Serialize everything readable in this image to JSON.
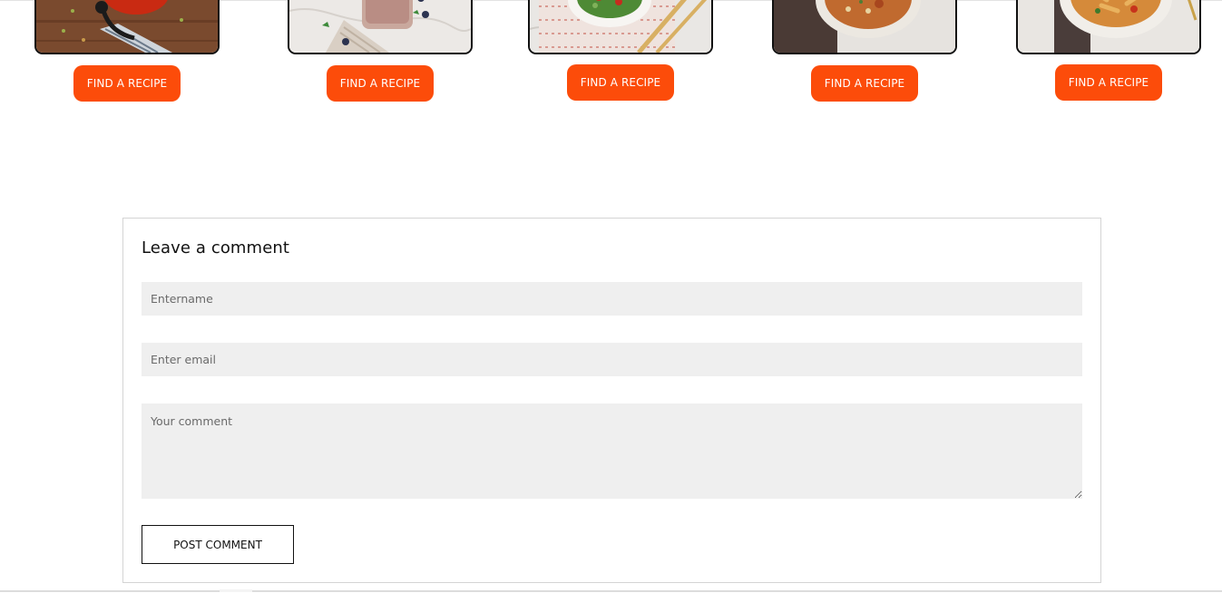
{
  "recipes": [
    {
      "button_label": "FIND A RECIPE",
      "image": "tomato-soup-photo"
    },
    {
      "button_label": "FIND A RECIPE",
      "image": "blueberry-smoothie-photo"
    },
    {
      "button_label": "FIND A RECIPE",
      "image": "green-salad-photo"
    },
    {
      "button_label": "FIND A RECIPE",
      "image": "quinoa-bowl-photo"
    },
    {
      "button_label": "FIND A RECIPE",
      "image": "pasta-bowl-photo"
    }
  ],
  "comment_form": {
    "title": "Leave a comment",
    "name_placeholder": "Entername",
    "email_placeholder": "Enter email",
    "comment_placeholder": "Your comment",
    "submit_label": "POST COMMENT"
  },
  "colors": {
    "accent": "#fc4c0a",
    "field_background": "#efefef",
    "border": "#d4d4d4"
  }
}
